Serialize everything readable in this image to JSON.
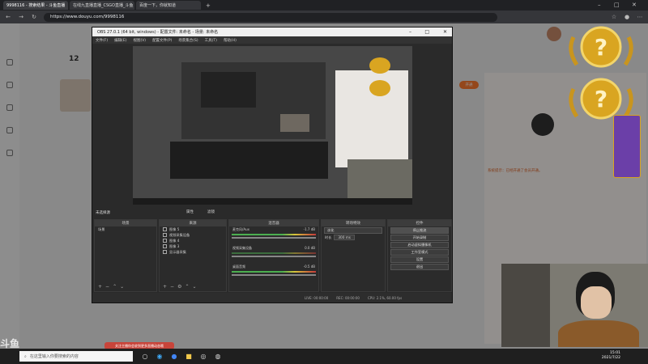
{
  "browser": {
    "tabs": [
      {
        "label": "9998116 - 搜索结果 - 斗鱼直播"
      },
      {
        "label": "在线九直播直播_CSGO直播_斗鱼"
      },
      {
        "label": "百度一下，你就知道"
      }
    ],
    "url": "https://www.douyu.com/9998116",
    "new_tab": "+"
  },
  "page": {
    "count": "12",
    "right_panel_text": "系统提示：已经开通了会员开通。",
    "right_panel_btn": "开通"
  },
  "obs": {
    "title": "OBS 27.0.1 (64 bit, windows) - 配置文件: 未命名 - 场景: 未命名",
    "menu": [
      "文件(F)",
      "编辑(E)",
      "视图(V)",
      "配置文件(P)",
      "场景集合(S)",
      "工具(T)",
      "帮助(H)"
    ],
    "scene_label": "未选择源",
    "props_btn": "属性",
    "filter_btn": "滤镜",
    "panels": {
      "scenes_title": "场景",
      "sources_title": "来源",
      "mixer_title": "混音器",
      "transitions_title": "转场特效",
      "controls_title": "控件"
    },
    "scenes": [
      "场景"
    ],
    "sources": [
      "图像 5",
      "视频采集设备",
      "图像 4",
      "图像 3",
      "显示器采集"
    ],
    "mixer": [
      {
        "name": "麦克风/Aux",
        "db": "-1.7 dB"
      },
      {
        "name": "视频采集设备",
        "db": "0.0 dB"
      },
      {
        "name": "桌面音频",
        "db": "-0.5 dB"
      }
    ],
    "transition": {
      "type": "淡化",
      "duration_label": "时长",
      "duration": "300 ms"
    },
    "controls": [
      "停止推流",
      "开始录制",
      "启动虚拟摄像机",
      "工作室模式",
      "设置",
      "退出"
    ],
    "status": {
      "live": "LIVE: 00:00:00",
      "rec": "REC: 00:00:00",
      "cpu": "CPU: 2.1%, 60.00 fps"
    }
  },
  "taskbar": {
    "search_placeholder": "在这里输入你要搜索的内容",
    "time": "15:01",
    "date": "2021/7/22"
  },
  "overlay": {
    "notice": "关注主播你会收到更多直播动态哦",
    "watermark": "斗鱼"
  },
  "colors": {
    "accent": "#ff7a2f",
    "obs_bg": "#2a2a2a",
    "medal_gold": "#d9a521"
  }
}
